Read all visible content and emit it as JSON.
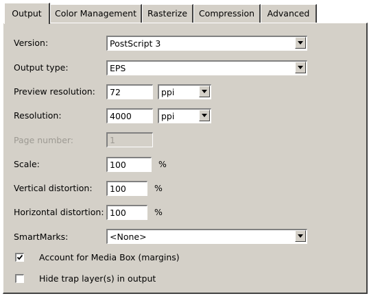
{
  "tabs": [
    {
      "label": "Output",
      "active": true
    },
    {
      "label": "Color Management",
      "active": false
    },
    {
      "label": "Rasterize",
      "active": false
    },
    {
      "label": "Compression",
      "active": false
    },
    {
      "label": "Advanced",
      "active": false
    }
  ],
  "form": {
    "version": {
      "label": "Version:",
      "value": "PostScript 3"
    },
    "output_type": {
      "label": "Output type:",
      "value": "EPS"
    },
    "preview_resolution": {
      "label": "Preview resolution:",
      "value": "72",
      "unit": "ppi"
    },
    "resolution": {
      "label": "Resolution:",
      "value": "4000",
      "unit": "ppi"
    },
    "page_number": {
      "label": "Page number:",
      "value": "1",
      "disabled": true
    },
    "scale": {
      "label": "Scale:",
      "value": "100",
      "unit": "%"
    },
    "vertical_distortion": {
      "label": "Vertical distortion:",
      "value": "100",
      "unit": "%"
    },
    "horizontal_distortion": {
      "label": "Horizontal distortion:",
      "value": "100",
      "unit": "%"
    },
    "smartmarks": {
      "label": "SmartMarks:",
      "value": "<None>"
    }
  },
  "checkboxes": {
    "account_media_box": {
      "label": "Account for Media Box (margins)",
      "checked": true
    },
    "hide_trap_layers": {
      "label": "Hide trap layer(s) in output",
      "checked": false
    }
  }
}
